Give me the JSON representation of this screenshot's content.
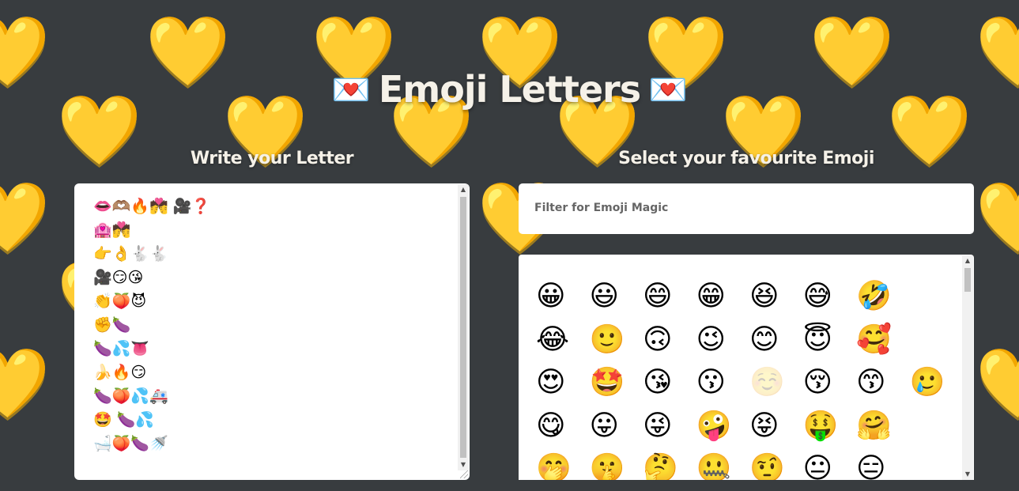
{
  "title": {
    "icon_left": "💌",
    "text": "Emoji Letters",
    "icon_right": "💌"
  },
  "background": {
    "icon": "💛",
    "color": "#383c3f"
  },
  "letter_panel": {
    "heading": "Write your Letter",
    "lines": [
      "👄🫶🏽🔥💏 🎥❓",
      "🏩💏",
      "👉👌🐇🐇",
      "🎥😏😘",
      "👏🍑😈",
      "✊🍆",
      "🍆💦👅",
      "🍌🔥😏",
      "🍆🍑💦🚑",
      "🤩 🍆💦",
      "🛁🍑🍆🚿"
    ]
  },
  "emoji_panel": {
    "heading": "Select your favourite Emoji",
    "filter_placeholder": "Filter for Emoji Magic",
    "rows": [
      [
        "😀",
        "😃",
        "😄",
        "😁",
        "😆",
        "😅",
        "🤣"
      ],
      [
        "😂",
        "🙂",
        "🙃",
        "😉",
        "😊",
        "😇",
        "🥰"
      ],
      [
        "😍",
        "🤩",
        "😘",
        "😗",
        "☺️",
        "😚",
        "😙",
        "🥲"
      ],
      [
        "😋",
        "😛",
        "😜",
        "🤪",
        "😝",
        "🤑",
        "🤗"
      ],
      [
        "🤭",
        "🤫",
        "🤔",
        "🤐",
        "🤨",
        "😐",
        "😑"
      ]
    ]
  }
}
